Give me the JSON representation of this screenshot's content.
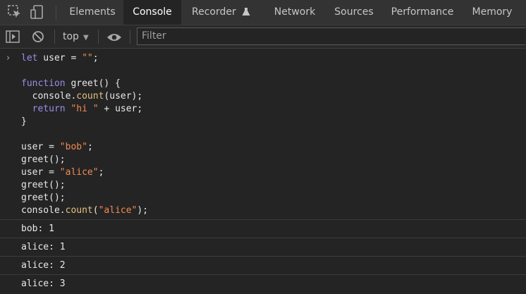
{
  "tabs": [
    {
      "label": "Elements"
    },
    {
      "label": "Console"
    },
    {
      "label": "Recorder"
    },
    {
      "label": "Network"
    },
    {
      "label": "Sources"
    },
    {
      "label": "Performance"
    },
    {
      "label": "Memory"
    }
  ],
  "active_tab": "Console",
  "toolbar": {
    "context": "top",
    "filter_placeholder": "Filter"
  },
  "icons": {
    "inspect": "inspect-element-icon",
    "device": "device-toolbar-icon",
    "recorder": "flask-icon",
    "sidebar": "show-sidebar-icon",
    "clear": "clear-console-icon",
    "live": "live-expression-eye-icon"
  },
  "code_lines": [
    [
      {
        "t": "k",
        "v": "let"
      },
      {
        "t": "p",
        "v": " user = "
      },
      {
        "t": "s",
        "v": "\"\""
      },
      {
        "t": "p",
        "v": ";"
      }
    ],
    [],
    [
      {
        "t": "k",
        "v": "function"
      },
      {
        "t": "p",
        "v": " greet() {"
      }
    ],
    [
      {
        "t": "p",
        "v": "  console."
      },
      {
        "t": "m",
        "v": "count"
      },
      {
        "t": "p",
        "v": "(user);"
      }
    ],
    [
      {
        "t": "p",
        "v": "  "
      },
      {
        "t": "k",
        "v": "return"
      },
      {
        "t": "p",
        "v": " "
      },
      {
        "t": "s",
        "v": "\"hi \""
      },
      {
        "t": "p",
        "v": " + user;"
      }
    ],
    [
      {
        "t": "p",
        "v": "}"
      }
    ],
    [],
    [
      {
        "t": "p",
        "v": "user = "
      },
      {
        "t": "s",
        "v": "\"bob\""
      },
      {
        "t": "p",
        "v": ";"
      }
    ],
    [
      {
        "t": "p",
        "v": "greet();"
      }
    ],
    [
      {
        "t": "p",
        "v": "user = "
      },
      {
        "t": "s",
        "v": "\"alice\""
      },
      {
        "t": "p",
        "v": ";"
      }
    ],
    [
      {
        "t": "p",
        "v": "greet();"
      }
    ],
    [
      {
        "t": "p",
        "v": "greet();"
      }
    ],
    [
      {
        "t": "p",
        "v": "console."
      },
      {
        "t": "m",
        "v": "count"
      },
      {
        "t": "p",
        "v": "("
      },
      {
        "t": "s",
        "v": "\"alice\""
      },
      {
        "t": "p",
        "v": ");"
      }
    ]
  ],
  "outputs": [
    "bob: 1",
    "alice: 1",
    "alice: 2",
    "alice: 3"
  ],
  "colors": {
    "keyword": "#9f8be9",
    "string": "#f28b54",
    "method": "#e6c17d",
    "text": "#e8e8e8"
  }
}
